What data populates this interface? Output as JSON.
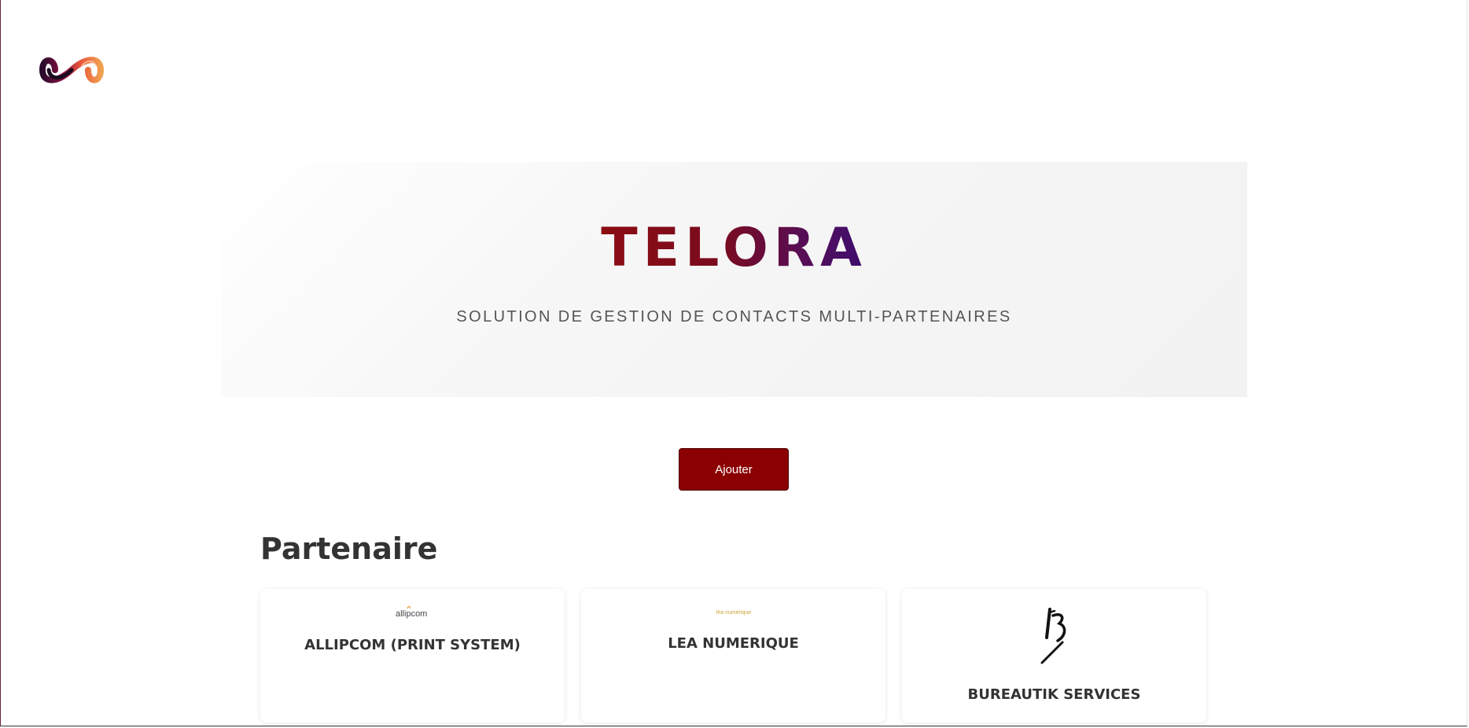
{
  "hero": {
    "title": "TELORA",
    "subtitle": "SOLUTION DE GESTION DE CONTACTS MULTI-PARTENAIRES"
  },
  "actions": {
    "add_label": "Ajouter"
  },
  "partners": {
    "heading": "Partenaire",
    "items": [
      {
        "name": "ALLIPCOM (PRINT SYSTEM)",
        "logo_text": "allipcom",
        "logo": "allipcom-logo"
      },
      {
        "name": "LEA NUMERIQUE",
        "logo_text": "léa numérique",
        "logo": "lea-numerique-logo"
      },
      {
        "name": "BUREAUTIK SERVICES",
        "logo": "bureautik-services-logo"
      }
    ]
  },
  "colors": {
    "brand_dark_red": "#8b0000",
    "title_gradient_start": "#8b0d12",
    "title_gradient_end": "#3e0d6e",
    "text_dark": "#333333"
  }
}
